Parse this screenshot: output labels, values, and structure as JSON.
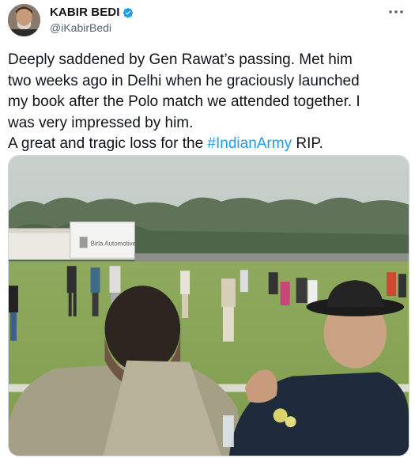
{
  "author": {
    "display_name": "KABIR BEDI",
    "handle": "@iKabirBedi",
    "verified": true,
    "avatar_icon": "profile-photo"
  },
  "menu_icon": "more-options-icon",
  "tweet": {
    "line1": "Deeply saddened by Gen Rawat’s passing. Met him",
    "line2": "two weeks ago in Delhi when he graciously launched",
    "line3": "my book after the Polo match we attended together. I",
    "line4": "was very impressed by him.",
    "line5_prefix": "A great and tragic loss for the ",
    "hashtag": "#IndianArmy",
    "line5_suffix": " RIP."
  },
  "media": {
    "sign_text": "Birla Automotive"
  },
  "colors": {
    "accent": "#1d9bf0",
    "text": "#0f1419",
    "secondary": "#536471"
  }
}
